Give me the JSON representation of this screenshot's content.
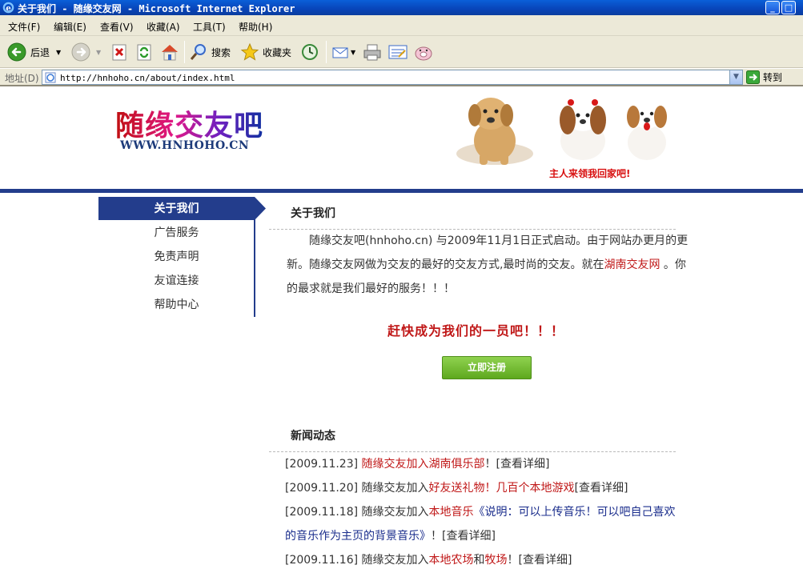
{
  "window": {
    "title": "关于我们 - 随缘交友网 - Microsoft Internet Explorer"
  },
  "menu": [
    "文件(F)",
    "编辑(E)",
    "查看(V)",
    "收藏(A)",
    "工具(T)",
    "帮助(H)"
  ],
  "toolbar": {
    "back_label": "后退",
    "search_label": "搜索",
    "favorites_label": "收藏夹"
  },
  "address": {
    "label": "地址(D)",
    "url": "http://hnhoho.cn/about/index.html",
    "go_label": "转到"
  },
  "site": {
    "logo_text": "随缘交友吧",
    "domain": "WWW.HNHOHO.CN",
    "slogan": "主人来领我回家吧!"
  },
  "sidebar": {
    "items": [
      {
        "label": "关于我们",
        "active": true
      },
      {
        "label": "广告服务",
        "active": false
      },
      {
        "label": "免责声明",
        "active": false
      },
      {
        "label": "友谊连接",
        "active": false
      },
      {
        "label": "帮助中心",
        "active": false
      }
    ]
  },
  "about": {
    "title": "关于我们",
    "text_1": "随缘交友吧(hnhoho.cn) 与2009年11月1日正式启动。由于网站办更月的更新。随缘交友网做为交友的最好的交友方式,最时尚的交友。就在",
    "link": "湖南交友网",
    "text_2": " 。你的最求就是我们最好的服务！！！",
    "cta": "赶快成为我们的一员吧！！！",
    "register_button": "立即注册"
  },
  "news": {
    "title": "新闻动态",
    "items": [
      {
        "date": "[2009.11.23]",
        "prefix": " ",
        "parts": [
          {
            "t": "随缘交友加入湖南俱乐部",
            "c": "red"
          },
          {
            "t": "！[查看详细]",
            "c": ""
          }
        ]
      },
      {
        "date": "[2009.11.20]",
        "prefix": " 随缘交友加入",
        "parts": [
          {
            "t": "好友送礼物！几百个本地游戏",
            "c": "red"
          },
          {
            "t": "[查看详细]",
            "c": ""
          }
        ]
      },
      {
        "date": "[2009.11.18]",
        "prefix": " 随缘交友加入",
        "parts": [
          {
            "t": "本地音乐",
            "c": "red"
          },
          {
            "t": "《说明：可以上传音乐！可以吧自己喜欢的音乐作为主页的背景音乐》",
            "c": "blue"
          },
          {
            "t": "！[查看详细]",
            "c": ""
          }
        ]
      },
      {
        "date": "[2009.11.16]",
        "prefix": " 随缘交友加入",
        "parts": [
          {
            "t": "本地农场",
            "c": "red"
          },
          {
            "t": "和",
            "c": ""
          },
          {
            "t": "牧场",
            "c": "red"
          },
          {
            "t": "！[查看详细]",
            "c": ""
          }
        ]
      }
    ]
  },
  "colors": {
    "accent": "#233d8c",
    "link_red": "#c01818",
    "button_green": "#6bb528"
  }
}
